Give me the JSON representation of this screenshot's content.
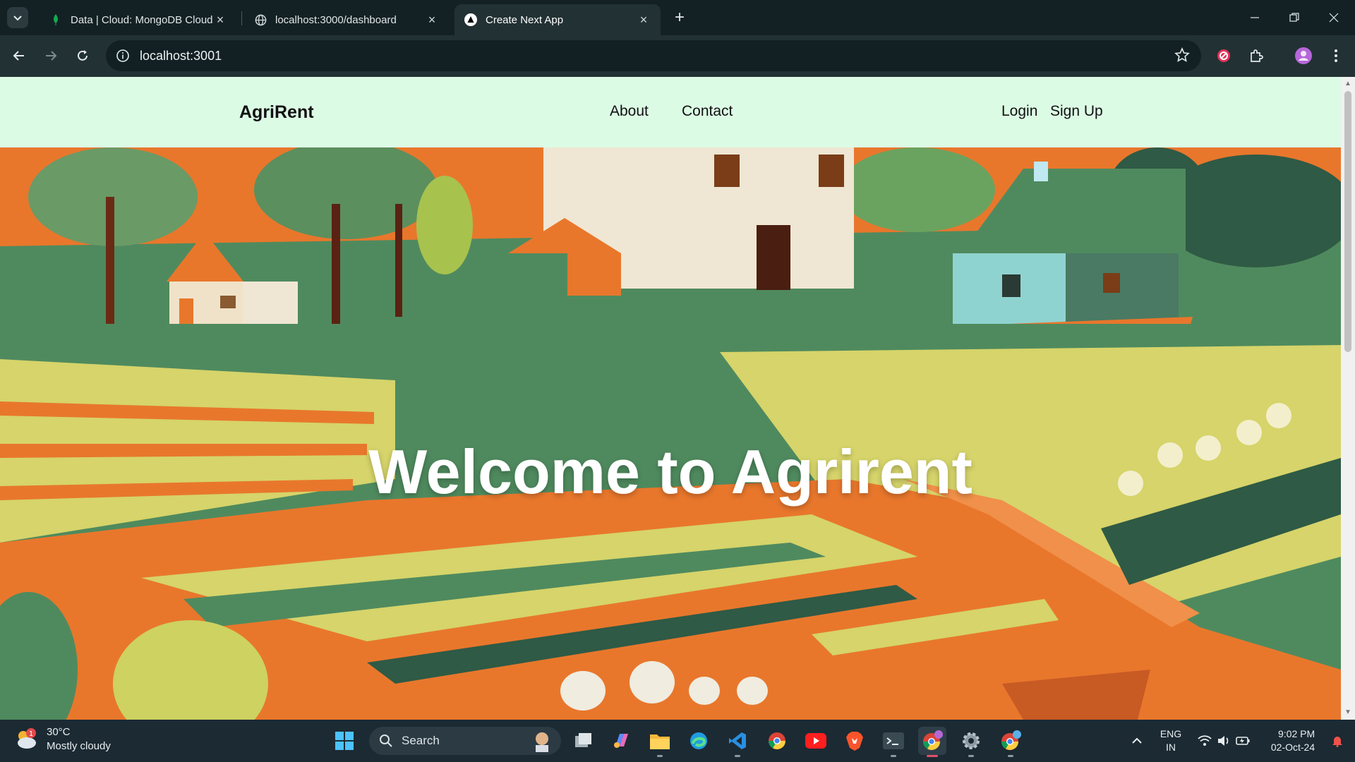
{
  "browser": {
    "tabs": [
      {
        "title": "Data | Cloud: MongoDB Cloud",
        "favicon": "mongodb-leaf-icon",
        "active": false
      },
      {
        "title": "localhost:3000/dashboard",
        "favicon": "globe-icon",
        "active": false
      },
      {
        "title": "Create Next App",
        "favicon": "nextjs-triangle-icon",
        "active": true
      }
    ],
    "new_tab_label": "+",
    "url": "localhost:3001"
  },
  "site": {
    "brand": "AgriRent",
    "nav": {
      "about": "About",
      "contact": "Contact",
      "login": "Login",
      "signup": "Sign Up"
    },
    "hero_title": "Welcome to Agrirent",
    "colors": {
      "navbar_bg": "#dcfbe5",
      "hero_orange": "#e8772c",
      "hero_green": "#4f8a5e",
      "hero_yellow": "#d6d46a"
    }
  },
  "taskbar": {
    "weather": {
      "temp": "30°C",
      "condition": "Mostly cloudy",
      "badge": "1"
    },
    "search_label": "Search",
    "apps": [
      "task-view-icon",
      "copilot-icon",
      "file-explorer-icon",
      "edge-icon",
      "vscode-icon",
      "chrome-icon",
      "youtube-icon",
      "brave-icon",
      "terminal-icon",
      "chrome-profile-icon",
      "settings-icon",
      "chrome-alt-icon"
    ],
    "tray": {
      "lang_top": "ENG",
      "lang_bottom": "IN",
      "time": "9:02 PM",
      "date": "02-Oct-24"
    }
  }
}
